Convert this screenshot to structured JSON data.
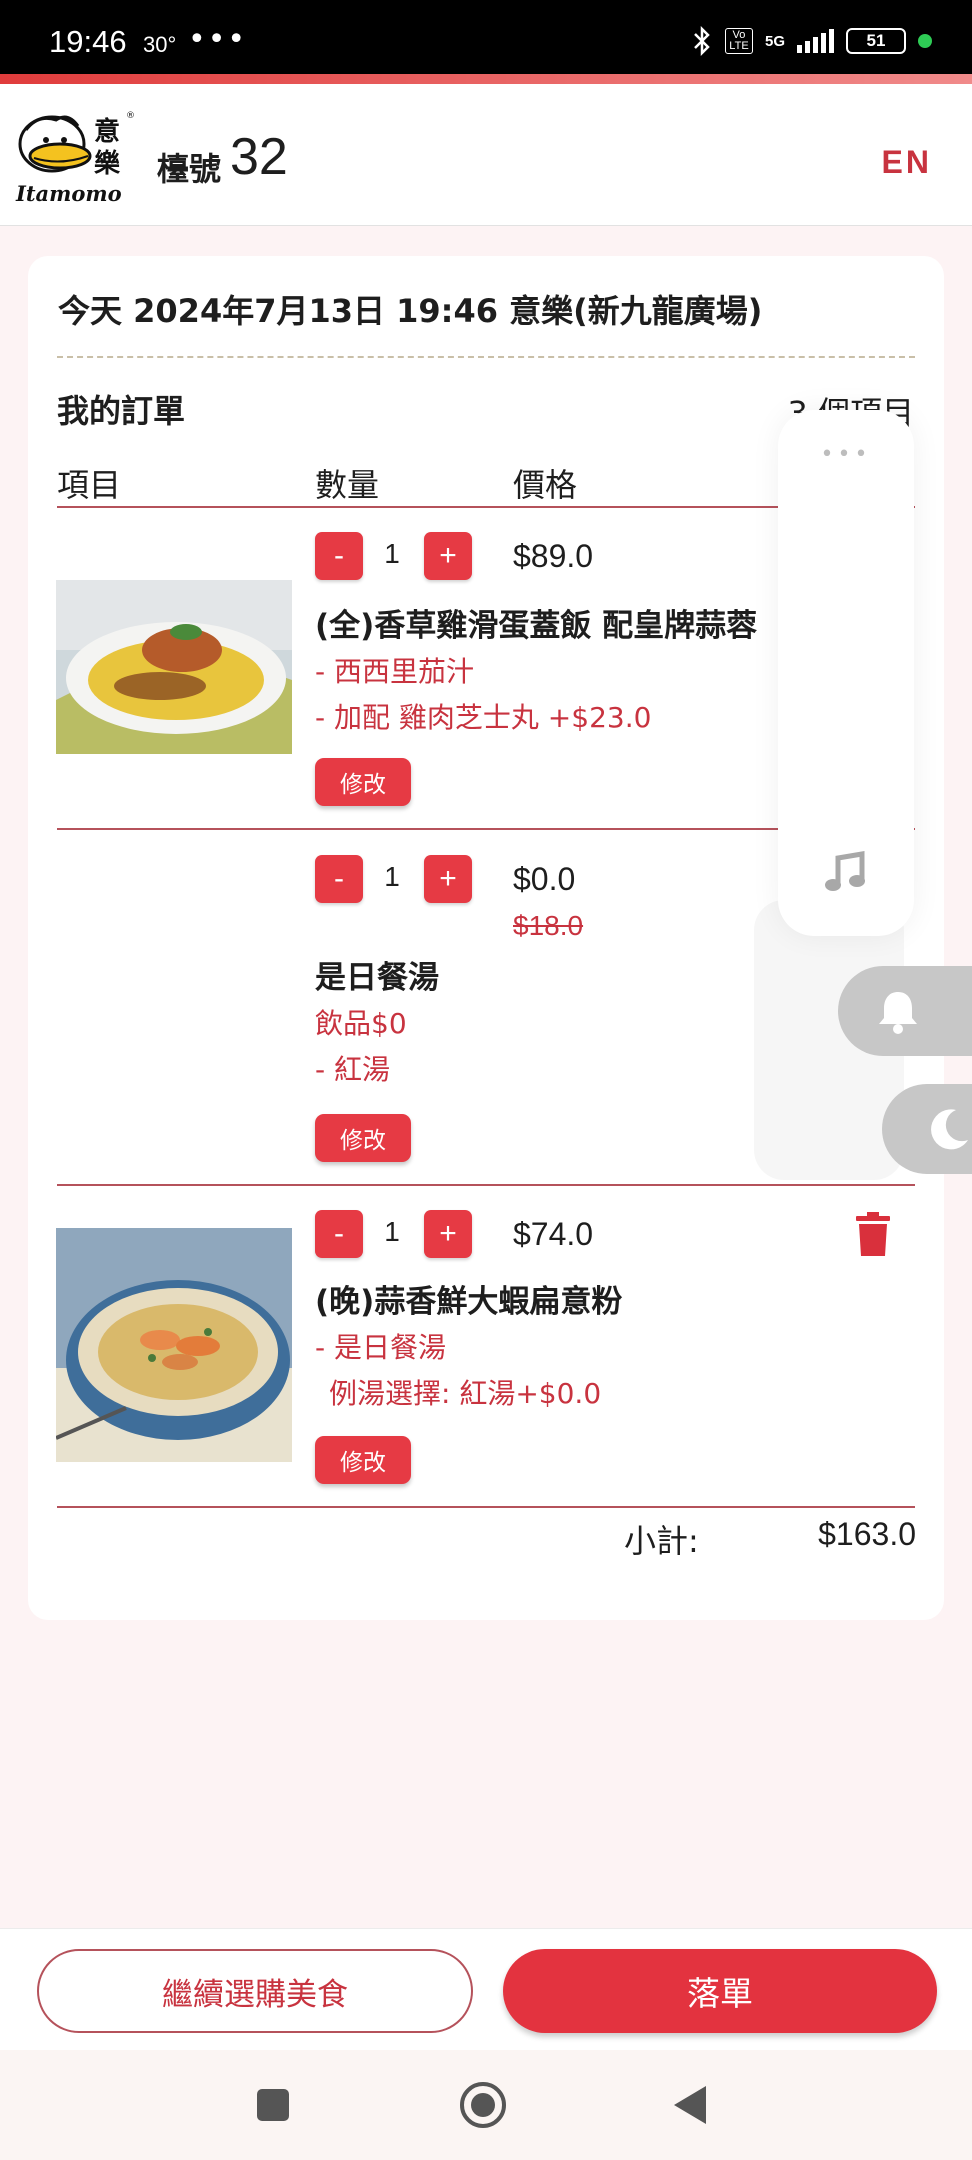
{
  "status_bar": {
    "time": "19:46",
    "temperature": "30°",
    "more": "•••",
    "network": "5G",
    "volte": "Vo LTE",
    "battery": "51"
  },
  "header": {
    "logo_text": "Itamomo",
    "logo_chinese": "意樂",
    "table_label": "檯號",
    "table_number": "32",
    "language": "EN"
  },
  "order": {
    "meta": "今天 2024年7月13日 19:46 意樂(新九龍廣場)",
    "title": "我的訂單",
    "count": "3 個項目",
    "columns": {
      "item": "項目",
      "qty": "數量",
      "price": "價格"
    },
    "items": [
      {
        "qty": "1",
        "price": "$89.0",
        "name": "(全)香草雞滑蛋蓋飯 配皇牌蒜蓉",
        "options": [
          "- 西西里茄汁",
          "- 加配 雞肉芝士丸 +$23.0"
        ],
        "image": "chicken-omelette-rice",
        "edit_label": "修改"
      },
      {
        "qty": "1",
        "price": "$0.0",
        "old_price": "$18.0",
        "name": "是日餐湯",
        "options": [
          "飲品$0",
          "- 紅湯"
        ],
        "edit_label": "修改"
      },
      {
        "qty": "1",
        "price": "$74.0",
        "name": "(晚)蒜香鮮大蝦扁意粉",
        "options": [
          "- 是日餐湯",
          "例湯選擇: 紅湯+$0.0"
        ],
        "image": "garlic-prawn-linguine",
        "edit_label": "修改"
      }
    ],
    "minus": "-",
    "plus": "+",
    "subtotal_label": "小計:",
    "subtotal_value": "$163.0"
  },
  "floating_panel": {
    "menu_dots": "•••",
    "icons": [
      "music-icon",
      "bell-icon",
      "moon-icon"
    ]
  },
  "actions": {
    "continue": "繼續選購美食",
    "submit": "落單"
  },
  "colors": {
    "accent": "#e63a44",
    "text_red": "#c8333f",
    "divider": "#b5525b",
    "background": "#fdf3f4"
  }
}
